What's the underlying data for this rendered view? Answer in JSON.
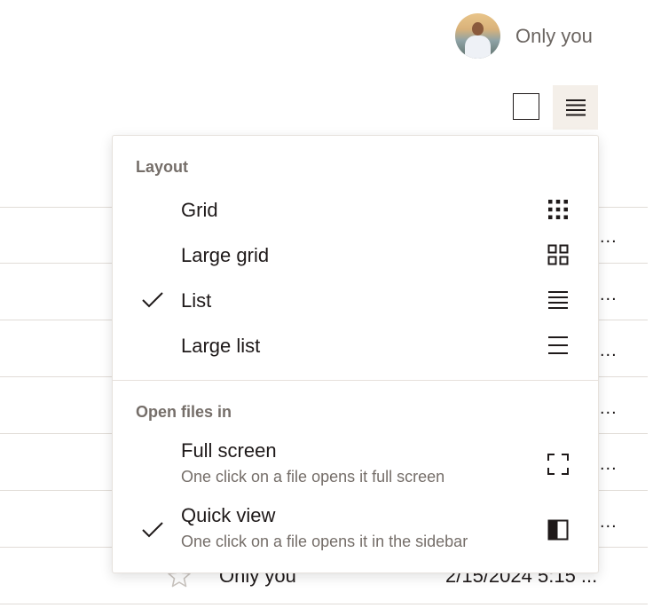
{
  "header": {
    "owner_label": "Only you",
    "avatar_icon": "user-avatar-photo"
  },
  "view_toggle": {
    "grid_icon": "grid-view-icon",
    "list_icon": "list-view-icon",
    "active": "list"
  },
  "table": {
    "visible_row": {
      "access": "Only you",
      "modified": "2/15/2024 5:15 ...",
      "star_icon": "star-outline-icon"
    },
    "row_ellipsis": "..."
  },
  "menu": {
    "layout_title": "Layout",
    "layout_items": [
      {
        "label": "Grid",
        "icon": "grid-icon",
        "checked": false
      },
      {
        "label": "Large grid",
        "icon": "large-grid-icon",
        "checked": false
      },
      {
        "label": "List",
        "icon": "list-icon",
        "checked": true
      },
      {
        "label": "Large list",
        "icon": "large-list-icon",
        "checked": false
      }
    ],
    "open_title": "Open files in",
    "open_items": [
      {
        "label": "Full screen",
        "description": "One click on a file opens it full screen",
        "icon": "fullscreen-icon",
        "checked": false
      },
      {
        "label": "Quick view",
        "description": "One click on a file opens it in the sidebar",
        "icon": "sidebar-icon",
        "checked": true
      }
    ]
  },
  "colors": {
    "text": "#1e1919",
    "muted": "#756e69",
    "active_bg": "#f4efe9",
    "divider": "#e1dcd7"
  }
}
